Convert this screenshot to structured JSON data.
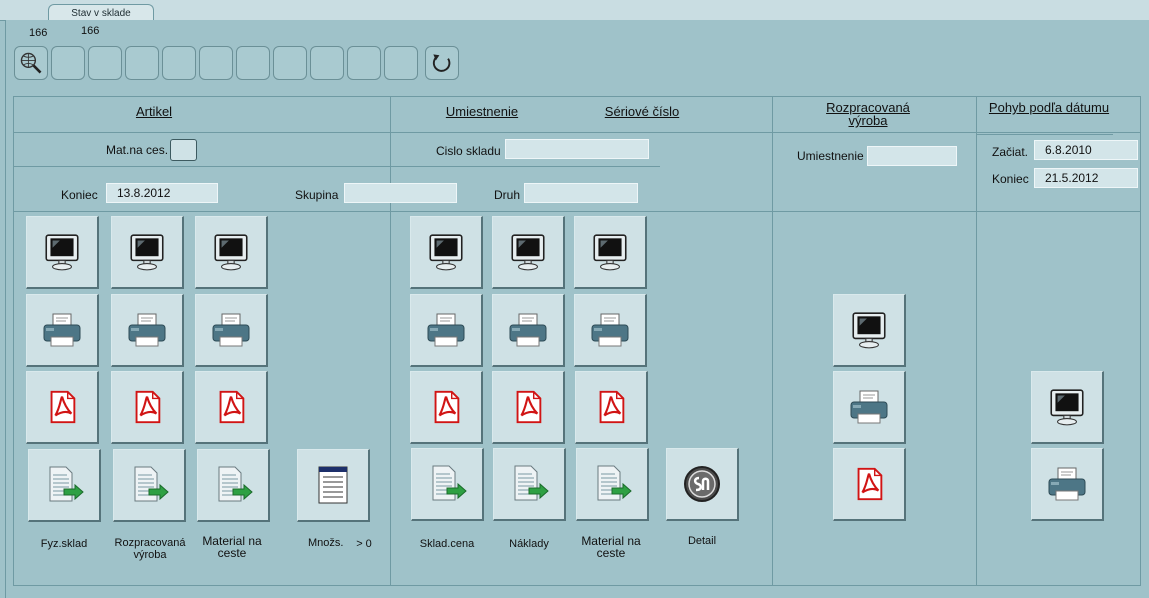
{
  "tab": {
    "label": "Stav v sklade"
  },
  "toolbar": {
    "count_top": "166",
    "count_sub": "166"
  },
  "headers": {
    "artikel": "Artikel",
    "umiestnenie": "Umiestnenie",
    "seriove": "Sériové číslo",
    "rozpracovana": "Rozpracovaná výroba",
    "pohyb": "Pohyb podľa dátumu"
  },
  "filters": {
    "mat_na_ces": "Mat.na ces.",
    "cislo_skladu": "Cislo skladu",
    "cislo_skladu_value": "",
    "koniec_label": "Koniec",
    "koniec_value": "13.8.2012",
    "skupina_label": "Skupina",
    "skupina_value": "",
    "druh_label": "Druh",
    "druh_value": "",
    "umiestnenie_label": "Umiestnenie",
    "umiestnenie_value": "",
    "zaciat_label": "Začiat.",
    "zaciat_value": "6.8.2010",
    "koniec2_label": "Koniec",
    "koniec2_value": "21.5.2012"
  },
  "captions": {
    "fyz_sklad": "Fyz.sklad",
    "rozp_vyroba_1": "Rozpracovaná",
    "rozp_vyroba_2": "výroba",
    "material_1": "Material na",
    "material_2": "ceste",
    "mnozs": "Množs.",
    "mnozs_cond": "> 0",
    "sklad_cena": "Sklad.cena",
    "naklady": "Náklady",
    "material2_1": "Material na",
    "material2_2": "ceste",
    "detail": "Detail"
  },
  "icons": {
    "monitor": "monitor-icon",
    "printer": "printer-icon",
    "pdf": "pdf-icon",
    "export": "export-doc-icon",
    "list": "list-icon",
    "detail": "sn-detail-icon",
    "zoom": "zoom-globe-icon",
    "refresh": "refresh-icon"
  },
  "colors": {
    "background": "#9fc2c9",
    "field": "#d3e5e9",
    "pdf_red": "#d11414",
    "arrow_green": "#2ea043"
  }
}
